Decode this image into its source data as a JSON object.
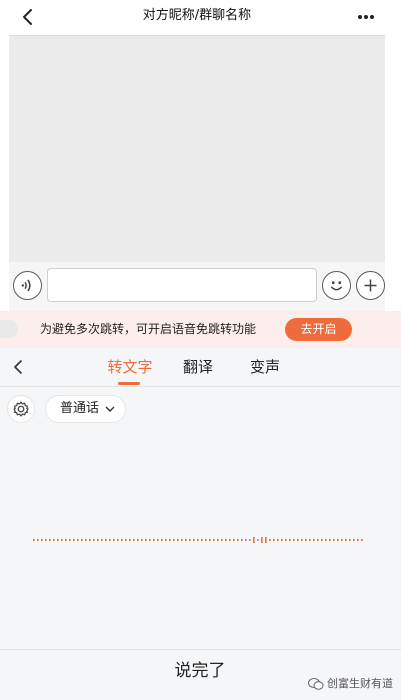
{
  "chat": {
    "title": "对方昵称/群聊名称",
    "back_icon": "chevron-left-icon",
    "more_icon": "more-dots-icon",
    "input_placeholder": "",
    "voice_icon": "voice-wave-icon",
    "emoji_icon": "smiley-icon",
    "plus_icon": "plus-icon"
  },
  "banner": {
    "text": "为避免多次跳转，可开启语音免跳转功能",
    "button_label": "去开启"
  },
  "panel": {
    "tabs": [
      {
        "label": "转文字",
        "active": true
      },
      {
        "label": "翻译",
        "active": false
      },
      {
        "label": "变声",
        "active": false
      }
    ],
    "language": "普通话",
    "done_label": "说完了"
  },
  "watermark": {
    "text": "创富生财有道"
  },
  "colors": {
    "accent": "#ee6c3b",
    "banner_bg": "#fdeeee",
    "panel_bg": "#f5f6f8",
    "chat_bg": "#ebebeb"
  }
}
